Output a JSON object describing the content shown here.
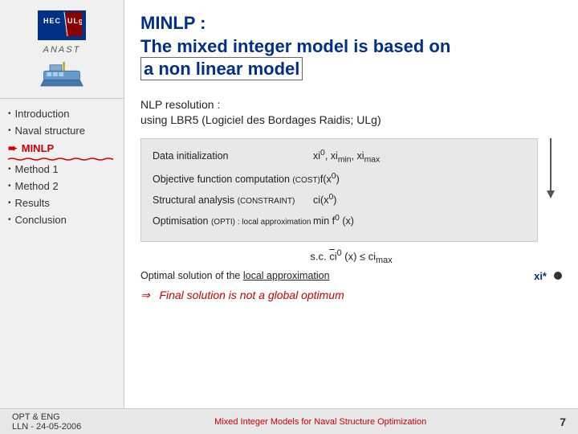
{
  "sidebar": {
    "logo": {
      "hec": "HEC",
      "ulg": "ULg",
      "anast": "ANAST"
    },
    "items": [
      {
        "label": "Introduction",
        "type": "bullet"
      },
      {
        "label": "Naval structure",
        "type": "bullet"
      },
      {
        "label": "MINLP",
        "type": "arrow",
        "active": true
      },
      {
        "label": "Method 1",
        "type": "bullet"
      },
      {
        "label": "Method 2",
        "type": "bullet"
      },
      {
        "label": "Results",
        "type": "bullet"
      },
      {
        "label": "Conclusion",
        "type": "bullet"
      }
    ]
  },
  "main": {
    "title_prefix": "MINLP :",
    "title_line2_part1": "The mixed integer model is based on",
    "title_line2_part2": "a non linear model",
    "subtitle_line1": "NLP resolution :",
    "subtitle_line2": "using LBR5 (Logiciel des Bordages Raidis; ULg)",
    "algo": {
      "row1_label": "Data initialization",
      "row1_value": "xi⁰, ximin, ximax",
      "row2_label": "Objective function computation",
      "row2_tag": "(COST)",
      "row2_value": "f(x⁰)",
      "row3_label": "Structural analysis",
      "row3_tag": "(CONSTRAINT)",
      "row3_value": "ci(x⁰)",
      "row4_label": "Optimisation",
      "row4_tag": "(OPTI) : local approximation",
      "row4_value": "min f⁰ (x)"
    },
    "sc_line": "s.c. ĉi⁰ (x) ≤ cimax",
    "optimal_label": "Optimal solution of the",
    "optimal_underline": "local approximation",
    "optimal_value": "xi*",
    "final_arrow": "⇒",
    "final_text": "Final solution is not a global optimum"
  },
  "footer": {
    "left": "OPT & ENG\nLLN - 24-05-2006",
    "center": "Mixed Integer Models for Naval Structure Optimization",
    "right": "7"
  }
}
